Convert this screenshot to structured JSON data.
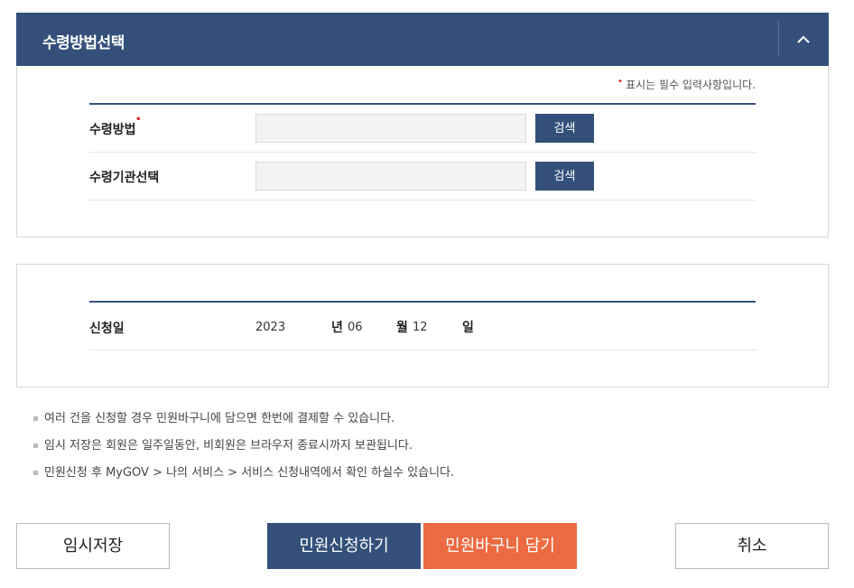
{
  "panel": {
    "title": "수령방법선택",
    "toggle_icon": "chevron-up-icon"
  },
  "required_note": {
    "marker": "•",
    "text": "표시는 필수 입력사항입니다."
  },
  "form": {
    "rows": [
      {
        "label": "수령방법",
        "required": true,
        "value": "",
        "button": "검색"
      },
      {
        "label": "수령기관선택",
        "required": false,
        "value": "",
        "button": "검색"
      }
    ]
  },
  "date": {
    "label": "신청일",
    "year": "2023",
    "year_unit": "년",
    "month": "06",
    "month_unit": "월",
    "day": "12",
    "day_unit": "일"
  },
  "notes": [
    "여러 건을 신청할 경우 민원바구니에 담으면 한번에 결제할 수 있습니다.",
    "임시 저장은 회원은 일주일동안, 비회원은 브라우저 종료시까지 보관됩니다.",
    "민원신청 후 MyGOV > 나의 서비스 > 서비스 신청내역에서 확인 하실수 있습니다."
  ],
  "actions": {
    "temp_save": "임시저장",
    "apply": "민원신청하기",
    "basket": "민원바구니 담기",
    "cancel": "취소"
  },
  "colors": {
    "primary": "#34507a",
    "accent": "#ec6a41",
    "required": "#e21c1c"
  }
}
